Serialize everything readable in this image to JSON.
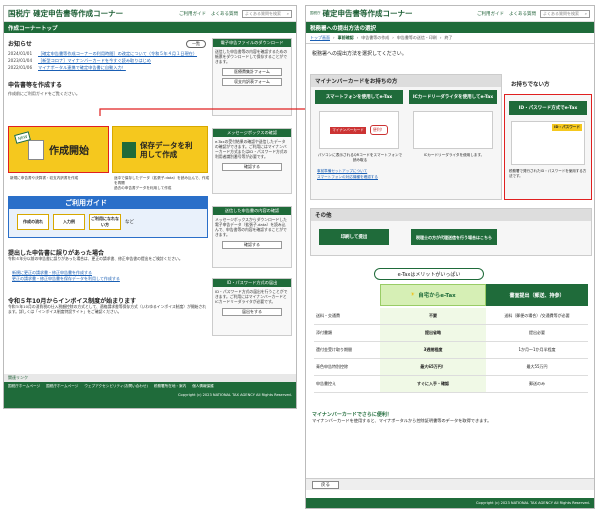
{
  "left": {
    "brand": "国税庁 確定申告書等作成コーナー",
    "header_links": [
      "ご利用ガイド",
      "よくある質問"
    ],
    "search_placeholder": "よくある質問を検索",
    "bar_title": "作成コーナートップ",
    "news_title": "お知らせ",
    "news_more": "一覧",
    "news": [
      {
        "date": "2024/01/01",
        "text": "［確定申告書等作成コーナーの利用時間］の改定について（令和５年４月１日現在）"
      },
      {
        "date": "2023/01/04",
        "text": "［新型コロナ］マイナンバーカードを今すぐ読み取りはじめ"
      },
      {
        "date": "2022/01/06",
        "text": "マイナポータル連携で確定申告書に自動入力！"
      }
    ],
    "create_title": "申告書等を作成する",
    "create_desc": "作成前にご利用ガイドをご覧ください。",
    "start_label": "作成開始",
    "new_badge": "NEW",
    "start_note": "新規に申告書や決算書・収支内訳書を作成",
    "resume_label": "保存データを利用して作成",
    "resume_notes": [
      "途中で保存したデータ（拡張子.data）を読み込んで、作成を再開",
      "過去の申告書データを利用して作成"
    ],
    "guide_title": "ご利用ガイド",
    "guide_items": [
      "作成の流れ",
      "入力例",
      "ご利用になれない方"
    ],
    "guide_etc": "など",
    "corr_title": "提出した申告書に誤りがあった場合",
    "corr_desc": "令和４年分以前の申告書に誤りがあった場合は、更正の請求書、修正申告書の提出をご検討ください。",
    "corr_links": [
      "新規に更正の請求書・修正申告書を作成する",
      "更正の請求書・修正申告書を保存データを利用して作成する"
    ],
    "invoice_title": "令和５年10月からインボイス制度が始まります",
    "invoice_desc": "令和５年10月の消費税の仕入税額控除の方式として、適格請求書等保存方式（いわゆるインボイス制度）が開始されます。詳しくは「インボイス制度特設サイト」をご確認ください。",
    "side": [
      {
        "title": "電子申告ファイルのダウンロード",
        "body": "送信した申告書等の内容を確認するための帳票をダウンロードして保存することができます。",
        "buttons": [
          "医療費集計フォーム",
          "収支内訳表フォーム"
        ]
      },
      {
        "title": "メッセージボックスの確認",
        "body": "e-Taxの受付結果の確認や送信したデータの確認ができます。ご利用にはマイナンバーカード方式またはID・パスワード方式の利用者識別番号等が必要です。",
        "buttons": [
          "確認する"
        ]
      },
      {
        "title": "送信した申告書の内容の確認",
        "body": "メッセージボックスからダウンロードした電子申告データ（拡張子.data）を読み込んで、申告書等の内容を確認することができます。",
        "buttons": [
          "確認する"
        ]
      },
      {
        "title": "ID・パスワード方式の届出",
        "body": "ID・パスワード方式の届出を行うことができます。ご利用にはマイナンバーカードとICカードリーダライタが必要です。",
        "buttons": [
          "届出をする"
        ]
      }
    ],
    "footer_title": "関連リンク",
    "footer_links": [
      "国税庁ホームページ",
      "国税庁ホームページ",
      "ウェブアクセシビリティ(お問い合わせ)",
      "税務署所在地・案内",
      "個人情報保護"
    ],
    "copyright": "Copyright (c) 2023 NATIONAL TAX AGENCY All Rights Reserved."
  },
  "right": {
    "brand_small": "国税庁",
    "brand": "確定申告書等作成コーナー",
    "header_links": [
      "ご利用ガイド",
      "よくある質問"
    ],
    "search_placeholder": "よくある質問を検索",
    "bar_title": "税務署への提出方法の選択",
    "steps": [
      "トップ画面",
      "事前確認",
      "申告書等の作成",
      "申告書等の送信・印刷",
      "終了"
    ],
    "question": "税務署への提出方法を選択してください。",
    "mycard_title": "マイナンバーカードをお持ちの方",
    "no_card_title": "お持ちでない方",
    "smartphone_btn": "スマートフォンを使用してe-Tax",
    "icreader_btn": "ICカードリーダライタを使用してe-Tax",
    "idpw_btn": "ID・パスワード方式でe-Tax",
    "smartphone_cap": "パソコンに表示されるQRコードをスマートフォンで読み取る",
    "icreader_cap": "ICカードリーダライタを使用します。",
    "idpw_cap": "税務署で発行されたID・パスワードを使用する方法です。",
    "mynumber_label": "マイナンバーカード",
    "convenient": "便利！",
    "idpw_label": "ID・パスワード",
    "note_links": [
      "事前準備セットアップについて",
      "スマートフォンの対応機種を確認する"
    ],
    "other_title": "その他",
    "print_btn": "印刷して提出",
    "tax_acct_btn": "税理士の方が代理送信を行う場合はこちら",
    "merit_title": "e-Taxはメリットがいっぱい",
    "col_etax": "自宅からe-Tax",
    "col_paper": "書面提出（郵送、持参）",
    "rows": [
      {
        "label": "送料・交通費",
        "etax": "不要",
        "paper": "送料（郵便の場合）/交通費等が必要"
      },
      {
        "label": "添付書類",
        "etax": "提出省略",
        "paper": "提出必要"
      },
      {
        "label": "還付金受け取り期間",
        "etax": "3週間程度",
        "paper": "1か月～1か月半程度"
      },
      {
        "label": "青色申告特別控除",
        "etax": "最大65万円！",
        "paper": "最大55万円"
      },
      {
        "label": "申告書控え",
        "etax": "すぐに入手・確認",
        "paper": "郵送のみ"
      }
    ],
    "mycard_more": "マイナンバーカードでさらに便利！",
    "mycard_more_desc": "マイナンバーカードを使用すると、マイナポータルから控除証明書等のデータを取得できます。",
    "back_btn": "戻る",
    "copyright": "Copyright (c) 2023 NATIONAL TAX AGENCY All Rights Reserved."
  },
  "colors": {
    "green": "#1f6b3a",
    "yellow": "#f5c81e",
    "red": "#e02020",
    "blue": "#2a6fc9"
  }
}
